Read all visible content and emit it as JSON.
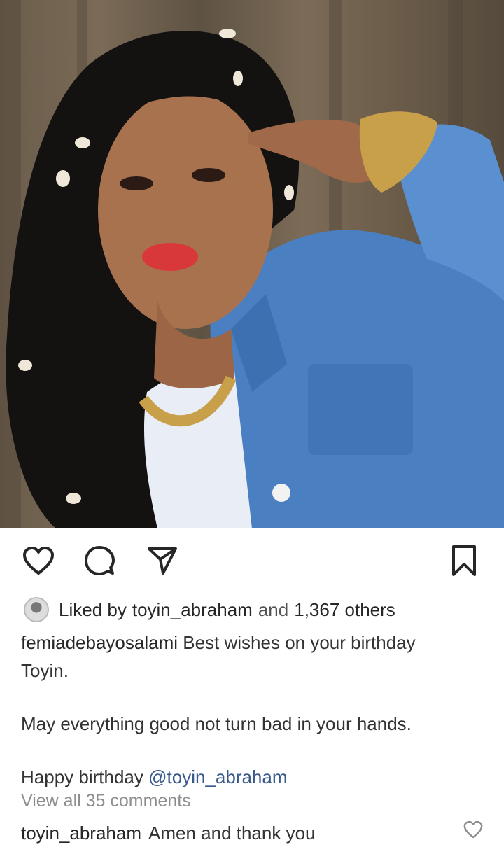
{
  "post": {
    "image": {
      "description_icon": "photo"
    },
    "actions": {
      "like_icon": "heart-icon",
      "comment_icon": "comment-bubble-icon",
      "share_icon": "paper-plane-icon",
      "save_icon": "bookmark-icon"
    },
    "likes": {
      "prefix": "Liked by",
      "user": "toyin_abraham",
      "connector": "and",
      "others": "1,367 others"
    },
    "caption": {
      "username": "femiadebayosalami",
      "line1": "Best wishes on your birthday",
      "line2": "Toyin.",
      "line3": "May everything good not turn bad in your hands.",
      "line4_prefix": "Happy birthday",
      "line4_mention": "@toyin_abraham"
    },
    "view_all_comments": "View all 35 comments",
    "comment": {
      "username": "toyin_abraham",
      "text": "Amen and thank you"
    }
  },
  "colors": {
    "text": "#262626",
    "secondary": "#8e8e8e",
    "mention": "#3a5a8c"
  }
}
